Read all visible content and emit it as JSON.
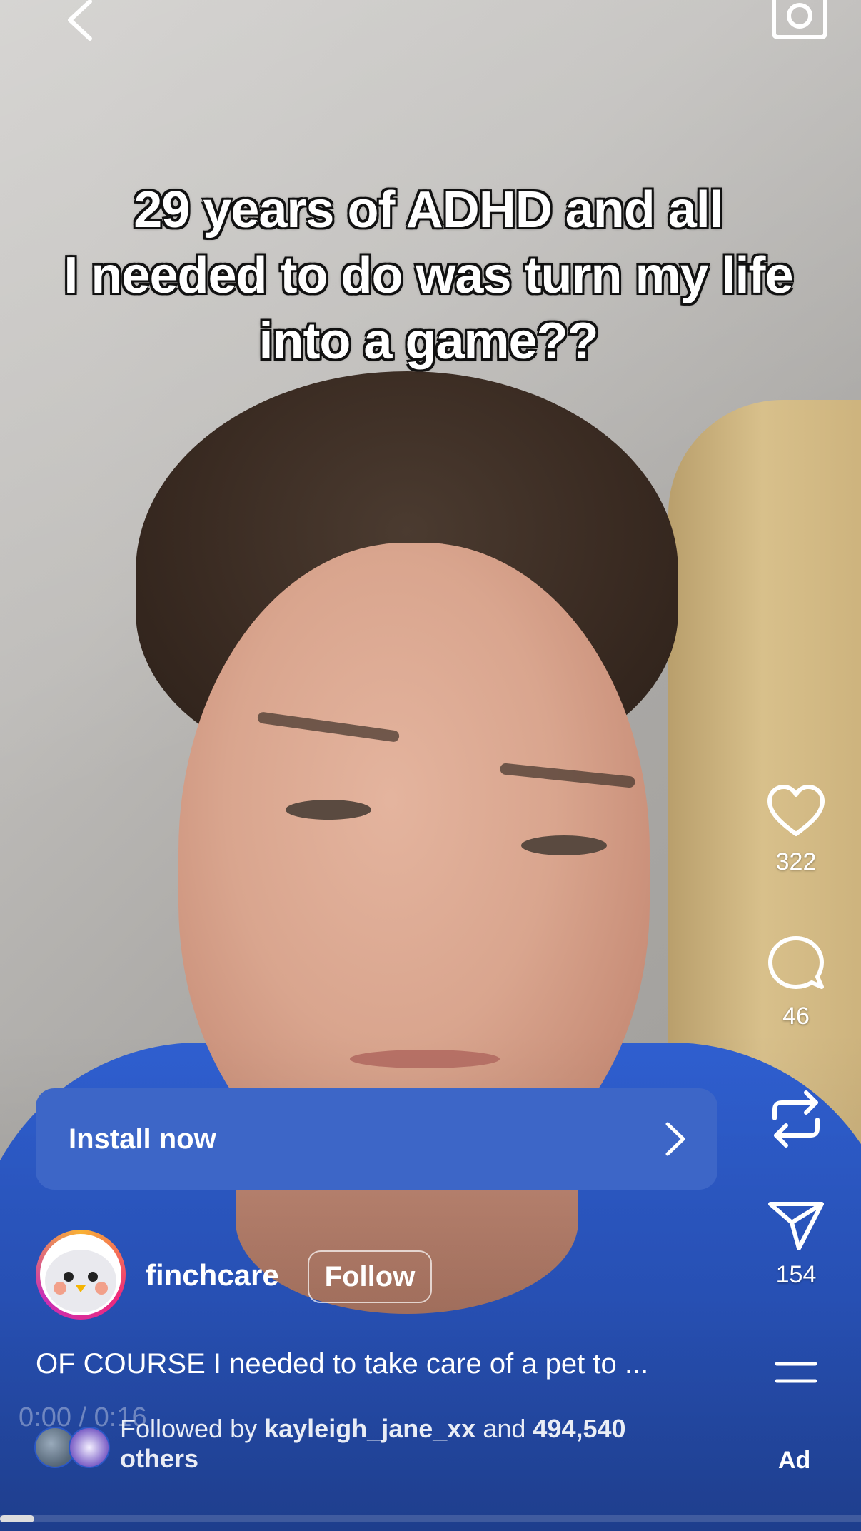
{
  "caption": {
    "line1": "29 years of ADHD and all",
    "line2": "I needed to do was turn my life",
    "line3": "into a game??"
  },
  "actions": {
    "like_count": "322",
    "comment_count": "46",
    "share_count": "154"
  },
  "install": {
    "label": "Install now"
  },
  "account": {
    "username": "finchcare",
    "follow_label": "Follow"
  },
  "description": "OF COURSE I needed to take care of a pet to ...",
  "timestamp": "0:00 / 0:16",
  "followed_by": {
    "prefix": "Followed by",
    "user": "kayleigh_jane_xx",
    "joiner": "and",
    "count": "494,540",
    "suffix": "others"
  },
  "ad_label": "Ad",
  "progress": 0.04,
  "icons": {
    "back": "chevron-left-icon",
    "camera": "camera-icon",
    "like": "heart-icon",
    "comment": "comment-icon",
    "repost": "repost-icon",
    "share": "send-icon",
    "more": "menu-icon",
    "install_arrow": "chevron-right-icon"
  },
  "colors": {
    "install_button": "#3d66c7",
    "sweater": "#2b58c6"
  }
}
